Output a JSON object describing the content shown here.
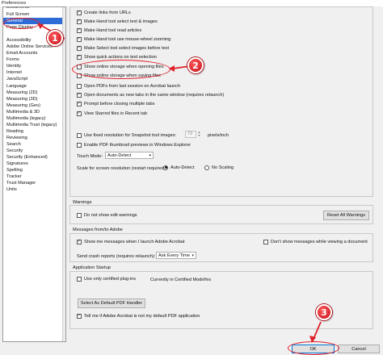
{
  "window": {
    "title": "Preferences"
  },
  "sidebar": {
    "items": [
      "Documents",
      "Full Screen",
      "General",
      "Page Display",
      "",
      "Accessibility",
      "Adobe Online Services",
      "Email Accounts",
      "Forms",
      "Identity",
      "Internet",
      "JavaScript",
      "Language",
      "Measuring (2D)",
      "Measuring (3D)",
      "Measuring (Geo)",
      "Multimedia & 3D",
      "Multimedia (legacy)",
      "Multimedia Trust (legacy)",
      "Reading",
      "Reviewing",
      "Search",
      "Security",
      "Security (Enhanced)",
      "Signatures",
      "Spelling",
      "Tracker",
      "Trust Manager",
      "Units"
    ],
    "selected_index": 2
  },
  "basic_tools": {
    "options": [
      {
        "label": "Create links from URLs",
        "checked": true
      },
      {
        "label": "Make Hand tool select text & images",
        "checked": true
      },
      {
        "label": "Make Hand tool read articles",
        "checked": true
      },
      {
        "label": "Make Hand tool use mouse-wheel zooming",
        "checked": true
      },
      {
        "label": "Make Select tool select images before text",
        "checked": true
      },
      {
        "label": "Show quick actions on text selection",
        "checked": true
      },
      {
        "label": "Show online storage when opening files",
        "checked": false
      },
      {
        "label": "Show online storage when saving files",
        "checked": false
      },
      {
        "label": "Open PDFs from last session on Acrobat launch",
        "checked": false
      },
      {
        "label": "Open documents as new tabs in the same window (requires relaunch)",
        "checked": true
      },
      {
        "label": "Prompt before closing multiple tabs",
        "checked": true
      },
      {
        "label": "View Starred files in Recent tab",
        "checked": true
      }
    ],
    "fixed_resolution": {
      "label": "Use fixed resolution for Snapshot tool images:",
      "checked": false,
      "value": "72",
      "unit": "pixels/inch"
    },
    "thumbnail": {
      "label": "Enable PDF thumbnail previews in Windows Explorer",
      "checked": false
    },
    "touch_mode": {
      "label": "Touch Mode:",
      "value": "Auto-Detect"
    },
    "scale": {
      "label": "Scale for screen resolution (restart required):",
      "options": [
        {
          "label": "Auto-Detect",
          "selected": true
        },
        {
          "label": "No Scaling",
          "selected": false
        }
      ]
    }
  },
  "warnings": {
    "title": "Warnings",
    "do_not_show": {
      "label": "Do not show edit warnings",
      "checked": false
    },
    "reset_button": "Reset All Warnings"
  },
  "messages": {
    "title": "Messages from/to Adobe",
    "show_launch": {
      "label": "Show me messages when I launch Adobe Acrobat",
      "checked": true
    },
    "dont_show_viewing": {
      "label": "Don't show messages while viewing a document",
      "checked": false
    },
    "crash_label": "Send crash reports (requires relaunch):",
    "crash_value": "Ask Every Time"
  },
  "startup": {
    "title": "Application Startup",
    "certified": {
      "label": "Use only certified plug-ins",
      "checked": false
    },
    "certified_mode_label": "Currently in Certified Mode:",
    "certified_mode_value": "Yes",
    "default_handler_button": "Select As Default PDF Handler",
    "tell_me": {
      "label": "Tell me if Adobe Acrobat is not my default PDF application",
      "checked": true
    }
  },
  "footer": {
    "ok": "OK",
    "cancel": "Cancel"
  },
  "annotations": {
    "step1": "1",
    "step2": "2",
    "step3": "3"
  },
  "colors": {
    "annotation": "#e0202a",
    "selection": "#2d6cd6"
  }
}
